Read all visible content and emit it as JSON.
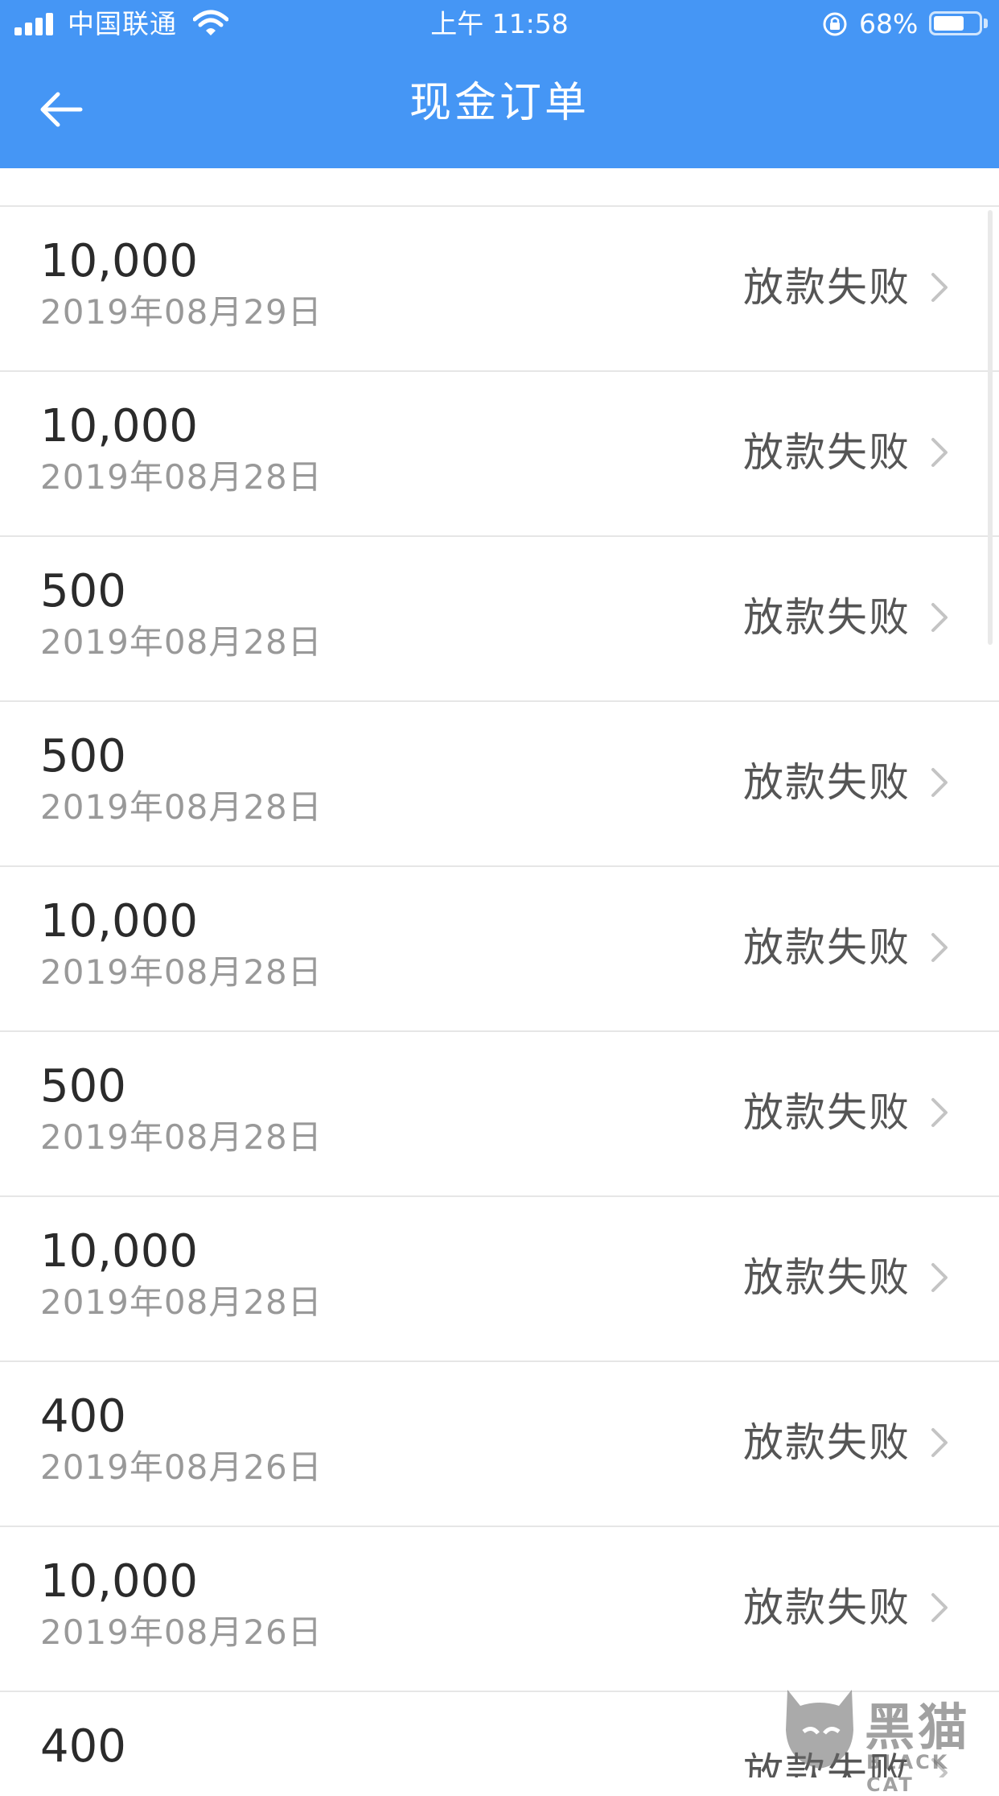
{
  "status_bar": {
    "carrier": "中国联通",
    "time": "上午 11:58",
    "battery_percent": "68%",
    "battery_level": 0.68
  },
  "nav": {
    "title": "现金订单"
  },
  "orders": [
    {
      "amount": "10,000",
      "date": "2019年08月29日",
      "status": "放款失败"
    },
    {
      "amount": "10,000",
      "date": "2019年08月28日",
      "status": "放款失败"
    },
    {
      "amount": "500",
      "date": "2019年08月28日",
      "status": "放款失败"
    },
    {
      "amount": "500",
      "date": "2019年08月28日",
      "status": "放款失败"
    },
    {
      "amount": "10,000",
      "date": "2019年08月28日",
      "status": "放款失败"
    },
    {
      "amount": "500",
      "date": "2019年08月28日",
      "status": "放款失败"
    },
    {
      "amount": "10,000",
      "date": "2019年08月28日",
      "status": "放款失败"
    },
    {
      "amount": "400",
      "date": "2019年08月26日",
      "status": "放款失败"
    },
    {
      "amount": "10,000",
      "date": "2019年08月26日",
      "status": "放款失败"
    },
    {
      "amount": "400",
      "date": "",
      "status": "放款失败"
    }
  ],
  "watermark": {
    "text": "黑猫",
    "sub": "BLACK CAT"
  },
  "colors": {
    "header": "#4596f5",
    "amount": "#2b2b2b",
    "date": "#999999",
    "status": "#555555",
    "divider": "#e6e6e6"
  }
}
